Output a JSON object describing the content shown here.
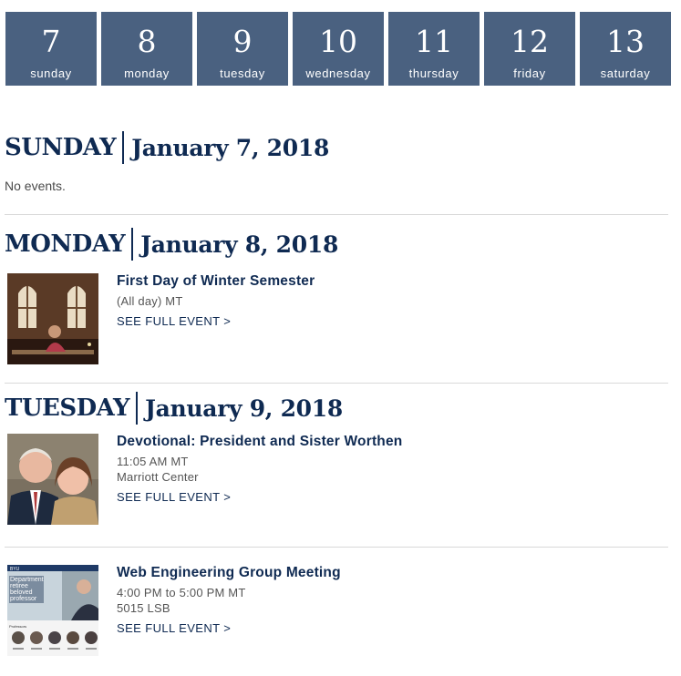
{
  "week": [
    {
      "num": "7",
      "name": "sunday"
    },
    {
      "num": "8",
      "name": "monday"
    },
    {
      "num": "9",
      "name": "tuesday"
    },
    {
      "num": "10",
      "name": "wednesday"
    },
    {
      "num": "11",
      "name": "thursday"
    },
    {
      "num": "12",
      "name": "friday"
    },
    {
      "num": "13",
      "name": "saturday"
    }
  ],
  "days": [
    {
      "dow": "SUNDAY",
      "date": "January 7, 2018",
      "no_events": "No events."
    },
    {
      "dow": "MONDAY",
      "date": "January 8, 2018"
    },
    {
      "dow": "TUESDAY",
      "date": "January 9, 2018"
    }
  ],
  "events": [
    {
      "title": "First Day of Winter Semester",
      "time": "(All day) MT",
      "location": "",
      "link": "SEE FULL EVENT >"
    },
    {
      "title": "Devotional: President and Sister Worthen",
      "time": "11:05 AM MT",
      "location": "Marriott Center",
      "link": "SEE FULL EVENT >"
    },
    {
      "title": "Web Engineering Group Meeting",
      "time": "4:00 PM to 5:00 PM MT",
      "location": "5015 LSB",
      "link": "SEE FULL EVENT >"
    }
  ],
  "colors": {
    "tile_bg": "#4a6180",
    "heading": "#0f2a52",
    "divider": "#d9d9d9"
  },
  "thumb_texts": {
    "brand": "BYU",
    "headline": "Department retiree beloved professor",
    "caption": "Professors"
  }
}
